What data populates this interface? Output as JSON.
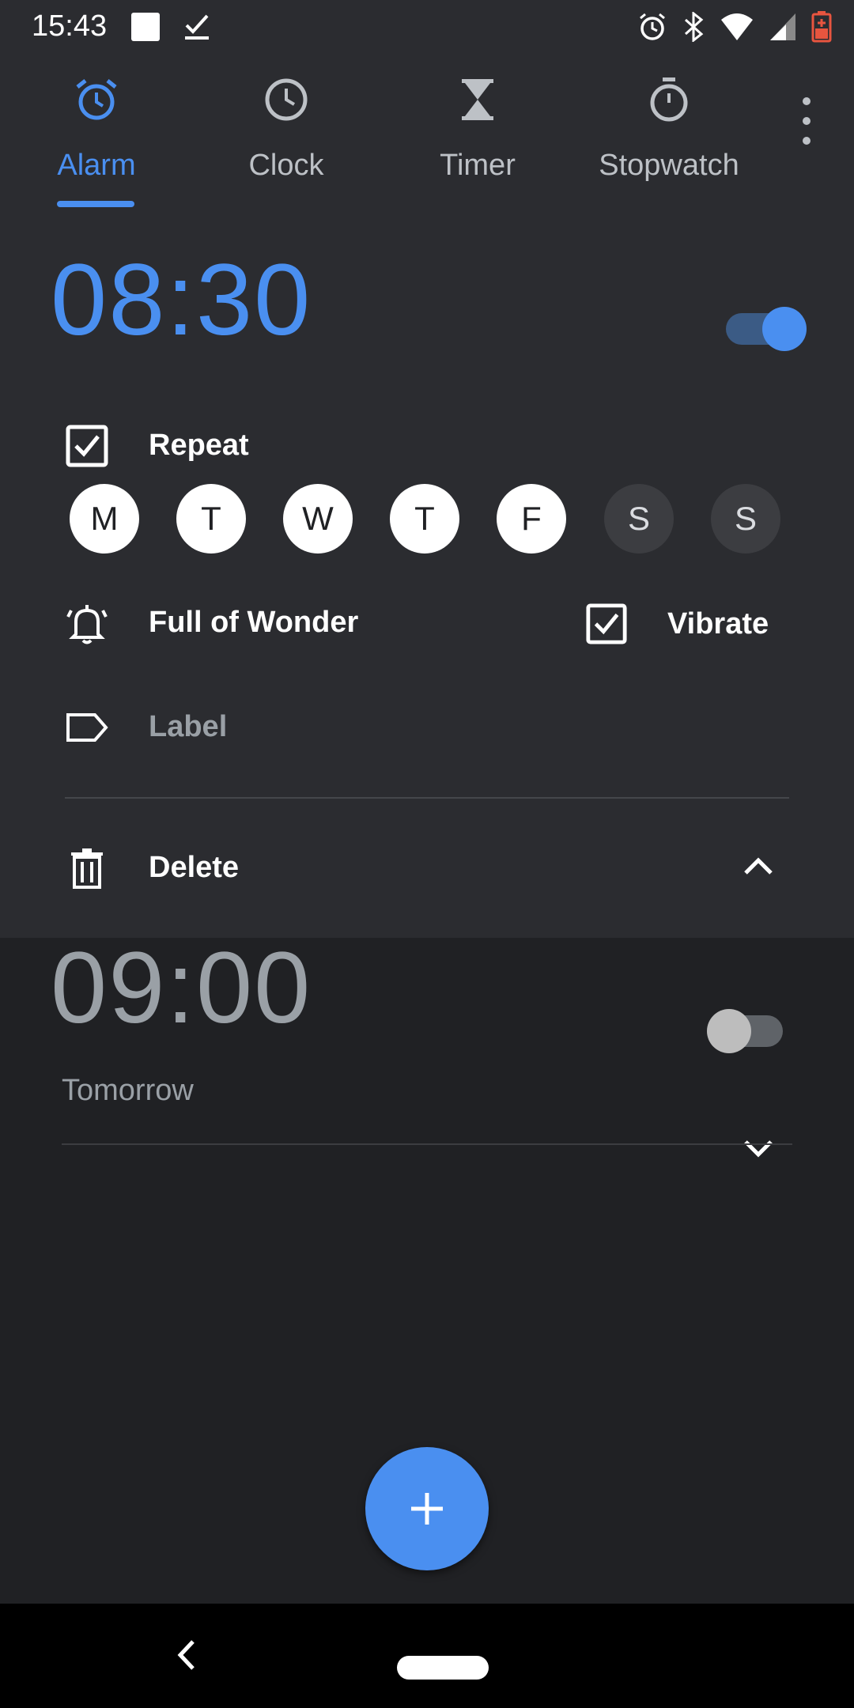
{
  "status_bar": {
    "time": "15:43",
    "left_icons": [
      "notification-square-icon",
      "task-check-icon"
    ],
    "right_icons": [
      "alarm-icon",
      "bluetooth-icon",
      "wifi-icon",
      "signal-icon",
      "battery-icon"
    ]
  },
  "tabs": [
    {
      "label": "Alarm",
      "icon": "alarm-clock-icon",
      "active": true
    },
    {
      "label": "Clock",
      "icon": "clock-icon",
      "active": false
    },
    {
      "label": "Timer",
      "icon": "hourglass-icon",
      "active": false
    },
    {
      "label": "Stopwatch",
      "icon": "stopwatch-icon",
      "active": false
    }
  ],
  "alarms": [
    {
      "time": "08:30",
      "enabled": true,
      "expanded": true,
      "repeat_label": "Repeat",
      "repeat_checked": true,
      "days": [
        {
          "letter": "M",
          "selected": true
        },
        {
          "letter": "T",
          "selected": true
        },
        {
          "letter": "W",
          "selected": true
        },
        {
          "letter": "T",
          "selected": true
        },
        {
          "letter": "F",
          "selected": true
        },
        {
          "letter": "S",
          "selected": false
        },
        {
          "letter": "S",
          "selected": false
        }
      ],
      "ringtone": "Full of Wonder",
      "vibrate_label": "Vibrate",
      "vibrate_checked": true,
      "label_placeholder": "Label",
      "delete_label": "Delete"
    },
    {
      "time": "09:00",
      "enabled": false,
      "expanded": false,
      "subtitle": "Tomorrow"
    }
  ],
  "colors": {
    "accent": "#4a8ff0",
    "background": "#202124",
    "surface": "#2b2c30"
  }
}
